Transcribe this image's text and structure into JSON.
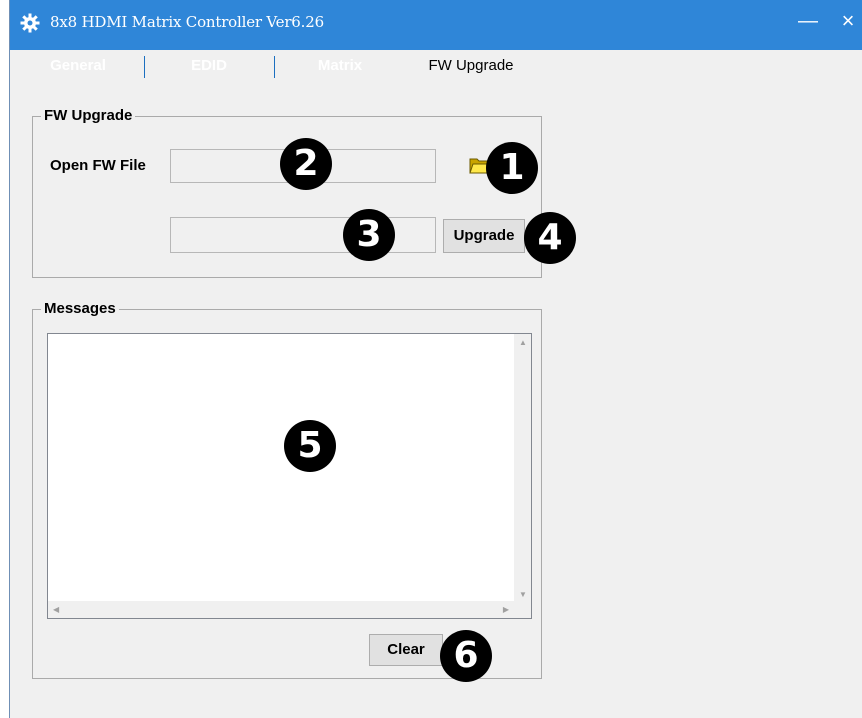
{
  "window": {
    "title": "8x8 HDMI Matrix Controller Ver6.26",
    "minimize_label": "—",
    "close_label": "×"
  },
  "tabs": [
    {
      "label": "General"
    },
    {
      "label": "EDID"
    },
    {
      "label": "Matrix"
    },
    {
      "label": "FW Upgrade",
      "active": true
    }
  ],
  "fw_group": {
    "title": "FW Upgrade",
    "open_label": "Open FW File",
    "file_value": "",
    "progress_value": "",
    "upgrade_button": "Upgrade",
    "folder_icon": "open-folder-icon"
  },
  "messages_group": {
    "title": "Messages",
    "messages_text": "",
    "clear_button": "Clear"
  },
  "callouts": {
    "c1": "1",
    "c2": "2",
    "c3": "3",
    "c4": "4",
    "c5": "5",
    "c6": "6"
  },
  "colors": {
    "titlebar": "#2f86d8",
    "window_bg": "#f0f0f0",
    "callout_bg": "#000000"
  }
}
